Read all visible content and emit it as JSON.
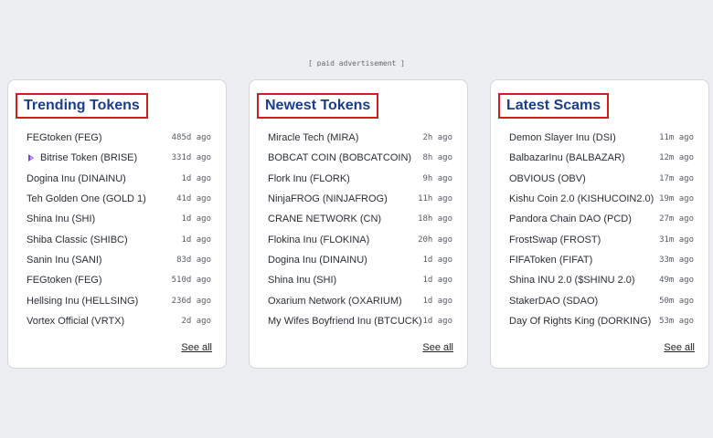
{
  "ad_label": "[ paid advertisement ]",
  "see_all_label": "See all",
  "sections": {
    "trending": {
      "title": "Trending Tokens",
      "items": [
        {
          "name": "FEGtoken (FEG)",
          "age": "485d ago"
        },
        {
          "name": "Bitrise Token (BRISE)",
          "age": "331d ago",
          "icon": "bitrise-logo-icon"
        },
        {
          "name": "Dogina Inu (DINAINU)",
          "age": "1d ago"
        },
        {
          "name": "Teh Golden One (GOLD 1)",
          "age": "41d ago"
        },
        {
          "name": "Shina Inu (SHI)",
          "age": "1d ago"
        },
        {
          "name": "Shiba Classic (SHIBC)",
          "age": "1d ago"
        },
        {
          "name": "Sanin Inu (SANI)",
          "age": "83d ago"
        },
        {
          "name": "FEGtoken (FEG)",
          "age": "510d ago"
        },
        {
          "name": "Hellsing Inu (HELLSING)",
          "age": "236d ago"
        },
        {
          "name": "Vortex Official (VRTX)",
          "age": "2d ago"
        }
      ]
    },
    "newest": {
      "title": "Newest Tokens",
      "items": [
        {
          "name": "Miracle Tech (MIRA)",
          "age": "2h ago"
        },
        {
          "name": "BOBCAT COIN (BOBCATCOIN)",
          "age": "8h ago"
        },
        {
          "name": "Flork Inu (FLORK)",
          "age": "9h ago"
        },
        {
          "name": "NinjaFROG (NINJAFROG)",
          "age": "11h ago"
        },
        {
          "name": "CRANE NETWORK (CN)",
          "age": "18h ago"
        },
        {
          "name": "Flokina Inu (FLOKINA)",
          "age": "20h ago"
        },
        {
          "name": "Dogina Inu (DINAINU)",
          "age": "1d ago"
        },
        {
          "name": "Shina Inu (SHI)",
          "age": "1d ago"
        },
        {
          "name": "Oxarium Network (OXARIUM)",
          "age": "1d ago"
        },
        {
          "name": "My Wifes Boyfriend Inu (BTCUCK)",
          "age": "1d ago"
        }
      ]
    },
    "scams": {
      "title": "Latest Scams",
      "items": [
        {
          "name": "Demon Slayer Inu (DSI)",
          "age": "11m ago"
        },
        {
          "name": "BalbazarInu (BALBAZAR)",
          "age": "12m ago"
        },
        {
          "name": "OBVIOUS (OBV)",
          "age": "17m ago"
        },
        {
          "name": "Kishu Coin 2.0 (KISHUCOIN2.0)",
          "age": "19m ago"
        },
        {
          "name": "Pandora Chain DAO (PCD)",
          "age": "27m ago"
        },
        {
          "name": "FrostSwap (FROST)",
          "age": "31m ago"
        },
        {
          "name": "FIFAToken (FIFAT)",
          "age": "33m ago"
        },
        {
          "name": "Shina INU 2.0 ($SHINU 2.0)",
          "age": "49m ago"
        },
        {
          "name": "StakerDAO (SDAO)",
          "age": "50m ago"
        },
        {
          "name": "Day Of Rights King (DORKING)",
          "age": "53m ago"
        }
      ]
    }
  },
  "colors": {
    "title_text": "#1a3e8a",
    "title_border": "#d11f1f",
    "page_background": "#eceef1",
    "bitrise_icon": "#7b3fe4"
  }
}
